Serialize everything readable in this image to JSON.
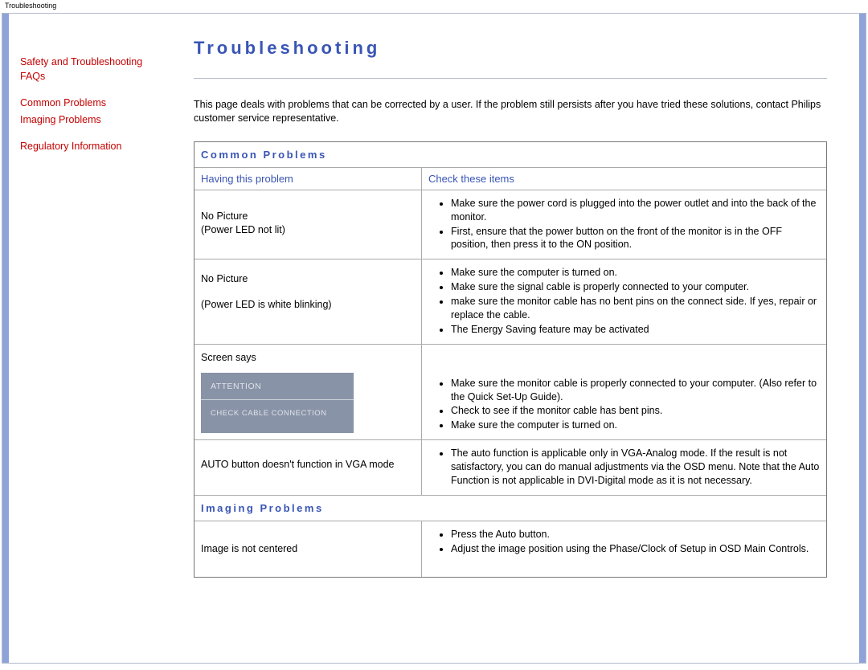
{
  "header_text": "Troubleshooting",
  "sidebar": {
    "items": [
      {
        "label": "Safety and Troubleshooting"
      },
      {
        "label": "FAQs"
      },
      {
        "label": "Common Problems"
      },
      {
        "label": "Imaging Problems"
      },
      {
        "label": "Regulatory Information"
      }
    ]
  },
  "page_title": "Troubleshooting",
  "intro": "This page deals with problems that can be corrected by a user. If the problem still persists after you have tried these solutions, contact Philips customer service representative.",
  "sections": {
    "common_problems": {
      "heading": "Common Problems",
      "col_left": "Having this problem",
      "col_right": "Check these items",
      "rows": [
        {
          "problem_line1": "No Picture",
          "problem_line2": "(Power LED not lit)",
          "solutions": [
            "Make sure the power cord is plugged into the power outlet and into the back of the monitor.",
            "First, ensure that the power button on the front of the monitor is in the OFF position, then press it to the ON position."
          ]
        },
        {
          "problem_line1": "No Picture",
          "problem_line2": "(Power LED is white blinking)",
          "solutions": [
            "Make sure the computer is turned on.",
            "Make sure the signal cable is properly connected to your computer.",
            "make sure the monitor cable has no bent pins on the connect side. If yes, repair or replace the cable.",
            "The Energy Saving feature may be activated"
          ]
        },
        {
          "problem_line1": "Screen says",
          "attention_title": "ATTENTION",
          "attention_msg": "CHECK CABLE CONNECTION",
          "solutions": [
            "Make sure the monitor cable is properly connected to your computer. (Also refer to the Quick Set-Up Guide).",
            "Check to see if the monitor cable has bent pins.",
            "Make sure the computer is turned on."
          ]
        },
        {
          "problem_line1": "AUTO button doesn't function in VGA mode",
          "solutions": [
            "The auto function is applicable only in VGA-Analog mode.  If the result is not satisfactory, you can do manual adjustments via the OSD menu.  Note that the Auto Function is not applicable in DVI-Digital mode as it is not necessary."
          ]
        }
      ]
    },
    "imaging_problems": {
      "heading": "Imaging Problems",
      "rows": [
        {
          "problem_line1": "Image is not centered",
          "solutions": [
            "Press the Auto button.",
            "Adjust the image position using the Phase/Clock of Setup in OSD Main Controls."
          ]
        }
      ]
    }
  }
}
